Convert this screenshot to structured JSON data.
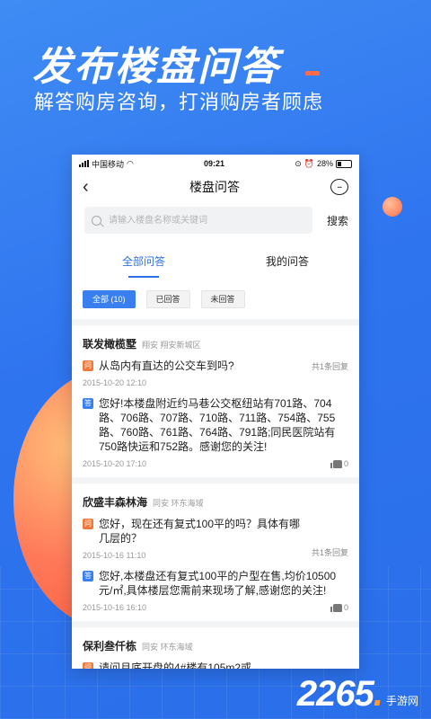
{
  "promo": {
    "title": "发布楼盘问答",
    "subtitle": "解答购房咨询，打消购房者顾虑"
  },
  "status_bar": {
    "carrier": "中国移动",
    "time": "09:21",
    "battery": "28%"
  },
  "nav": {
    "title": "楼盘问答"
  },
  "search": {
    "placeholder": "请输入楼盘名称或关键词",
    "button": "搜索"
  },
  "tabs": [
    {
      "label": "全部问答",
      "active": true
    },
    {
      "label": "我的问答",
      "active": false
    }
  ],
  "filters": [
    {
      "label": "全部 (10)",
      "active": true
    },
    {
      "label": "已回答",
      "active": false
    },
    {
      "label": "未回答",
      "active": false
    }
  ],
  "estates": [
    {
      "name": "联发橄榄墅",
      "meta": "翔安   翔安新城区",
      "question": "从岛内有直达的公交车到吗?",
      "reply_count": "共1条回复",
      "question_time": "2015-10-20 12:10",
      "answer": "您好!本楼盘附近约马巷公交枢纽站有701路、704路、706路、707路、710路、711路、754路、755路、760路、761路、764路、791路;同民医院站有750路快运和752路。感谢您的关注!",
      "answer_time": "2015-10-20 17:10",
      "likes": "0"
    },
    {
      "name": "欣盛丰森林海",
      "meta": "同安   环东海域",
      "question": "您好，现在还有复式100平的吗？具体有哪几层的？",
      "reply_count": "共1条回复",
      "question_time": "2015-10-16 11:10",
      "answer": "您好,本楼盘还有复式100平的户型在售,均价10500元/㎡,具体楼层您需前来现场了解,感谢您的关注!",
      "answer_time": "2015-10-16 16:10",
      "likes": "0"
    },
    {
      "name": "保利叁仟栋",
      "meta": "同安   环东海域",
      "question": "请问月底开盘的4#楼有105m2或"
    }
  ],
  "logo": {
    "number": "2265",
    "dot": ".",
    "suffix": "手游网"
  },
  "colors": {
    "brand_blue": "#2f74ef",
    "accent_orange": "#ff6b4a",
    "question_badge": "#f07a3a",
    "answer_badge": "#3a7ff0"
  }
}
